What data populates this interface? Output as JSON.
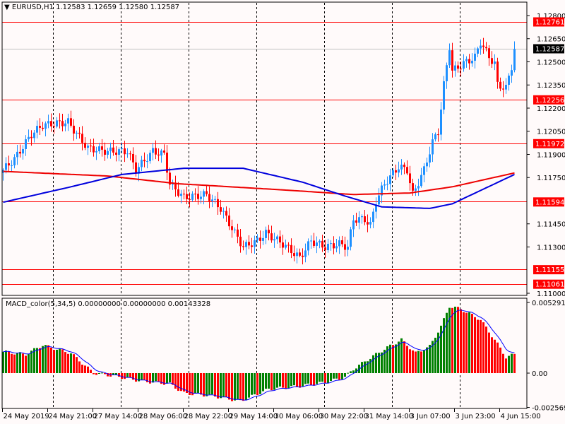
{
  "header": {
    "symbol": "EURUSD,H1",
    "ohlc": "1.12583 1.12659 1.12580 1.12587"
  },
  "macd_header": "MACD_color(5,34,5) 0.00000000 0.00000000 0.00143328",
  "colors": {
    "bg": "#fffafa",
    "up": "#1e90ff",
    "down": "#ff0000",
    "ma_fast": "#0000dd",
    "ma_slow": "#ee0000",
    "level": "#ff0000",
    "hist_up": "#008000",
    "hist_down": "#ff0000",
    "signal": "#0000ff"
  },
  "chart_data": [
    {
      "type": "candlestick",
      "title": "EURUSD,H1",
      "ylim": [
        1.1097,
        1.1285
      ],
      "price_ticks": [
        "1.12800",
        "1.12650",
        "1.12500",
        "1.12350",
        "1.12200",
        "1.12050",
        "1.11900",
        "1.11750",
        "1.11450",
        "1.11300",
        "1.11000"
      ],
      "x_labels": [
        {
          "bar": 0,
          "text": "24 May 2019"
        },
        {
          "bar": 16,
          "text": "24 May 21:00"
        },
        {
          "bar": 32,
          "text": "27 May 14:00"
        },
        {
          "bar": 48,
          "text": "28 May 06:00"
        },
        {
          "bar": 64,
          "text": "28 May 22:00"
        },
        {
          "bar": 80,
          "text": "29 May 14:00"
        },
        {
          "bar": 96,
          "text": "30 May 06:00"
        },
        {
          "bar": 112,
          "text": "30 May 22:00"
        },
        {
          "bar": 128,
          "text": "31 May 14:00"
        },
        {
          "bar": 144,
          "text": "3 Jun 07:00"
        },
        {
          "bar": 160,
          "text": "3 Jun 23:00"
        },
        {
          "bar": 176,
          "text": "4 Jun 15:00"
        }
      ],
      "bars": 182,
      "close_waypoints": [
        [
          0,
          1.118
        ],
        [
          4,
          1.1187
        ],
        [
          10,
          1.1203
        ],
        [
          14,
          1.1209
        ],
        [
          23,
          1.1211
        ],
        [
          27,
          1.1201
        ],
        [
          30,
          1.1194
        ],
        [
          37,
          1.1192
        ],
        [
          44,
          1.1192
        ],
        [
          47,
          1.118
        ],
        [
          53,
          1.1192
        ],
        [
          57,
          1.119
        ],
        [
          59,
          1.1171
        ],
        [
          64,
          1.1162
        ],
        [
          72,
          1.1164
        ],
        [
          77,
          1.1155
        ],
        [
          82,
          1.1139
        ],
        [
          85,
          1.113
        ],
        [
          90,
          1.1134
        ],
        [
          93,
          1.1139
        ],
        [
          99,
          1.1132
        ],
        [
          105,
          1.1123
        ],
        [
          109,
          1.1134
        ],
        [
          114,
          1.113
        ],
        [
          119,
          1.1132
        ],
        [
          122,
          1.113
        ],
        [
          124,
          1.1148
        ],
        [
          128,
          1.1148
        ],
        [
          130,
          1.1144
        ],
        [
          132,
          1.116
        ],
        [
          135,
          1.1171
        ],
        [
          140,
          1.1182
        ],
        [
          143,
          1.118
        ],
        [
          145,
          1.1164
        ],
        [
          149,
          1.118
        ],
        [
          152,
          1.1198
        ],
        [
          154,
          1.1205
        ],
        [
          156,
          1.1235
        ],
        [
          158,
          1.126
        ],
        [
          159,
          1.1244
        ],
        [
          163,
          1.1249
        ],
        [
          167,
          1.1253
        ],
        [
          169,
          1.1263
        ],
        [
          172,
          1.1253
        ],
        [
          174,
          1.1249
        ],
        [
          175,
          1.1235
        ],
        [
          178,
          1.1233
        ],
        [
          180,
          1.1247
        ],
        [
          181,
          1.12587
        ]
      ],
      "ma_slow_waypoints": [
        [
          0,
          1.1179
        ],
        [
          37,
          1.1176
        ],
        [
          62,
          1.1171
        ],
        [
          99,
          1.1167
        ],
        [
          124,
          1.1164
        ],
        [
          144,
          1.1165
        ],
        [
          159,
          1.1169
        ],
        [
          181,
          1.1178
        ]
      ],
      "ma_fast_waypoints": [
        [
          0,
          1.1159
        ],
        [
          24,
          1.1169
        ],
        [
          42,
          1.1177
        ],
        [
          64,
          1.1181
        ],
        [
          85,
          1.1181
        ],
        [
          106,
          1.1172
        ],
        [
          121,
          1.1163
        ],
        [
          134,
          1.1156
        ],
        [
          151,
          1.1155
        ],
        [
          159,
          1.1158
        ],
        [
          181,
          1.1177
        ]
      ],
      "levels": [
        "1.12761",
        "1.12256",
        "1.11972",
        "1.11594",
        "1.11155",
        "1.11061"
      ],
      "current_price": "1.12587"
    },
    {
      "type": "bar",
      "title": "MACD_color(5,34,5)",
      "ylim": [
        -0.002569,
        0.0052919
      ],
      "ticks": [
        "0.0052919",
        "0.00",
        "-0.002569"
      ],
      "hist_waypoints": [
        [
          0,
          0.0016
        ],
        [
          8,
          0.0014
        ],
        [
          14,
          0.0021
        ],
        [
          24,
          0.0015
        ],
        [
          32,
          0.0
        ],
        [
          39,
          -0.0002
        ],
        [
          49,
          -0.0006
        ],
        [
          59,
          -0.0008
        ],
        [
          64,
          -0.0015
        ],
        [
          74,
          -0.0017
        ],
        [
          84,
          -0.0021
        ],
        [
          94,
          -0.0012
        ],
        [
          104,
          -0.001
        ],
        [
          114,
          -0.0007
        ],
        [
          121,
          -0.0003
        ],
        [
          124,
          0.0003
        ],
        [
          129,
          0.001
        ],
        [
          135,
          0.0018
        ],
        [
          141,
          0.0025
        ],
        [
          146,
          0.0015
        ],
        [
          151,
          0.002
        ],
        [
          155,
          0.0035
        ],
        [
          158,
          0.005
        ],
        [
          162,
          0.0048
        ],
        [
          169,
          0.004
        ],
        [
          174,
          0.0025
        ],
        [
          178,
          0.0012
        ],
        [
          181,
          0.0014
        ]
      ]
    }
  ]
}
